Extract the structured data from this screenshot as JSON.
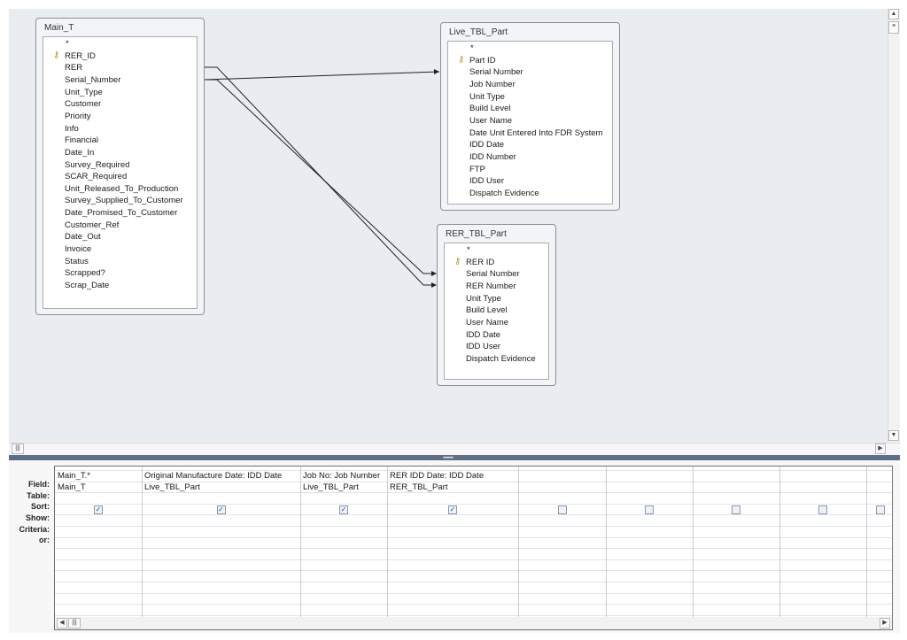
{
  "tables": [
    {
      "name": "Main_T",
      "fields": [
        "*",
        "RER_ID",
        "RER",
        "Serial_Number",
        "Unit_Type",
        "Customer",
        "Priority",
        "Info",
        "Financial",
        "Date_In",
        "Survey_Required",
        "SCAR_Required",
        "Unit_Released_To_Production",
        "Survey_Supplied_To_Customer",
        "Date_Promised_To_Customer",
        "Customer_Ref",
        "Date_Out",
        "Invoice",
        "Status",
        "Scrapped?",
        "Scrap_Date"
      ],
      "key": "RER_ID"
    },
    {
      "name": "Live_TBL_Part",
      "fields": [
        "*",
        "Part ID",
        "Serial Number",
        "Job Number",
        "Unit Type",
        "Build Level",
        "User Name",
        "Date Unit Entered Into FDR System",
        "IDD Date",
        "IDD Number",
        "FTP",
        "IDD User",
        "Dispatch Evidence"
      ],
      "key": "Part ID"
    },
    {
      "name": "RER_TBL_Part",
      "fields": [
        "*",
        "RER ID",
        "Serial Number",
        "RER Number",
        "Unit Type",
        "Build Level",
        "User Name",
        "IDD Date",
        "IDD User",
        "Dispatch Evidence"
      ],
      "key": "RER ID"
    }
  ],
  "grid": {
    "row_labels": [
      "Field:",
      "Table:",
      "Sort:",
      "Show:",
      "Criteria:",
      "or:"
    ],
    "columns": [
      {
        "field": "Main_T.*",
        "table": "Main_T",
        "show": true
      },
      {
        "field": "Original Manufacture Date: IDD Date",
        "table": "Live_TBL_Part",
        "show": true
      },
      {
        "field": "Job No: Job Number",
        "table": "Live_TBL_Part",
        "show": true
      },
      {
        "field": "RER IDD Date: IDD Date",
        "table": "RER_TBL_Part",
        "show": true
      },
      {
        "field": "",
        "table": "",
        "show": false
      },
      {
        "field": "",
        "table": "",
        "show": false
      },
      {
        "field": "",
        "table": "",
        "show": false
      },
      {
        "field": "",
        "table": "",
        "show": false
      },
      {
        "field": "",
        "table": "",
        "show": false
      }
    ]
  },
  "colors": {
    "design_bg": "#e9ecf0",
    "splitter": "#5e6e88",
    "key": "#b8952a"
  }
}
